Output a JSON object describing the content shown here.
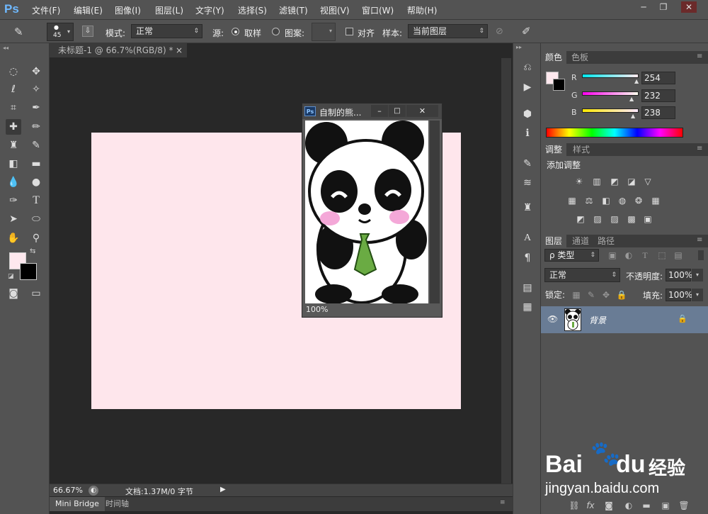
{
  "app": {
    "logo": "Ps"
  },
  "menu": [
    "文件(F)",
    "编辑(E)",
    "图像(I)",
    "图层(L)",
    "文字(Y)",
    "选择(S)",
    "滤镜(T)",
    "视图(V)",
    "窗口(W)",
    "帮助(H)"
  ],
  "window_controls": {
    "minimize": "─",
    "restore": "❐",
    "close": "✕"
  },
  "options": {
    "brush_size": "45",
    "mode_label": "模式:",
    "mode_value": "正常",
    "source_label": "源:",
    "sampled_label": "取样",
    "pattern_label": "图案:",
    "aligned_label": "对齐",
    "sample_label": "样本:",
    "sample_value": "当前图层"
  },
  "document": {
    "tab_title": "未标题-1 @ 66.7%(RGB/8) *",
    "canvas_color": "#fee6ec",
    "zoom": "66.67%",
    "doc_info": "文档:1.37M/0 字节"
  },
  "bottom_tabs": [
    "Mini Bridge",
    "时间轴"
  ],
  "floating_doc": {
    "title": "自制的熊...",
    "zoom": "100%"
  },
  "color_panel": {
    "tabs": [
      "颜色",
      "色板"
    ],
    "r_label": "R",
    "r_value": "254",
    "g_label": "G",
    "g_value": "232",
    "b_label": "B",
    "b_value": "238",
    "foreground": "#fee8ee",
    "background": "#000000"
  },
  "adjust_panel": {
    "tabs": [
      "调整",
      "样式"
    ],
    "heading": "添加调整"
  },
  "layers_panel": {
    "tabs": [
      "图层",
      "通道",
      "路径"
    ],
    "filter_label": "ρ 类型",
    "blend_mode": "正常",
    "opacity_label": "不透明度:",
    "opacity_value": "100%",
    "lock_label": "锁定:",
    "fill_label": "填充:",
    "fill_value": "100%",
    "layer_name": "背景"
  },
  "watermark": {
    "brand": "Bai",
    "brand2": "du",
    "brand_cn": "经验",
    "url": "jingyan.baidu.com"
  }
}
